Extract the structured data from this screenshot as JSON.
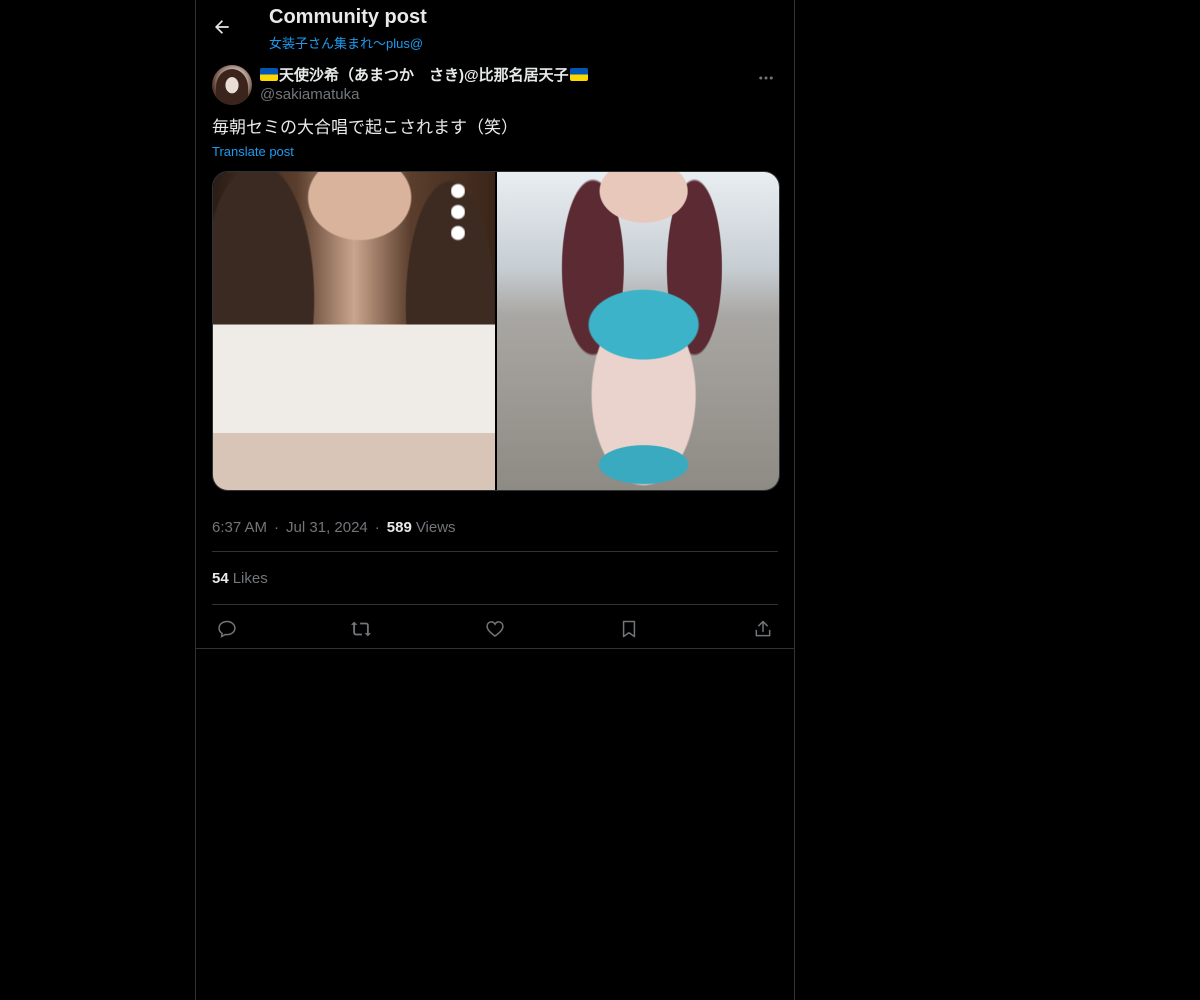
{
  "header": {
    "title": "Community post",
    "community": "女装子さん集まれ〜plus@"
  },
  "post": {
    "author_name": "天使沙希（あまつか　さき)@比那名居天子",
    "author_handle": "@sakiamatuka",
    "text": "毎朝セミの大合唱で起こされます（笑）",
    "translate_label": "Translate post",
    "time": "6:37 AM",
    "date": "Jul 31, 2024",
    "views_count": "589",
    "views_label": "Views",
    "likes_count": "54",
    "likes_label": "Likes",
    "separator": "·"
  },
  "icons": {
    "back": "arrow-left-icon",
    "more": "more-horizontal-icon",
    "reply": "reply-icon",
    "repost": "repost-icon",
    "like": "heart-icon",
    "bookmark": "bookmark-icon",
    "share": "share-icon"
  },
  "colors": {
    "background": "#000000",
    "text": "#e7e9ea",
    "secondary": "#71767b",
    "accent": "#1d9bf0",
    "border": "#2f3336"
  }
}
